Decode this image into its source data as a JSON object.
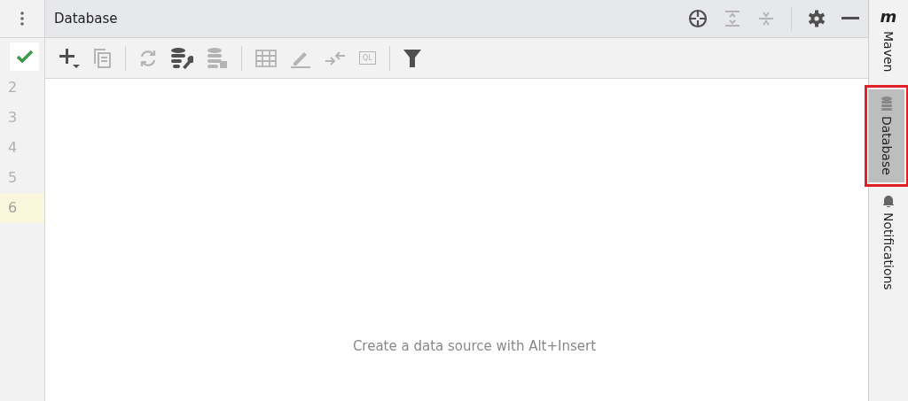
{
  "gutter": {
    "lines": [
      {
        "number": "2",
        "current": false
      },
      {
        "number": "3",
        "current": false
      },
      {
        "number": "4",
        "current": false
      },
      {
        "number": "5",
        "current": false
      },
      {
        "number": "6",
        "current": true
      }
    ]
  },
  "panel": {
    "title": "Database",
    "header_actions": [
      {
        "kind": "locate",
        "disabled": false
      },
      {
        "kind": "expand",
        "disabled": true
      },
      {
        "kind": "collapse",
        "disabled": true
      },
      {
        "kind": "separator"
      },
      {
        "kind": "settings",
        "disabled": false
      },
      {
        "kind": "minimize",
        "disabled": false
      }
    ],
    "toolbar": [
      {
        "kind": "add",
        "disabled": false
      },
      {
        "kind": "copy",
        "disabled": true
      },
      {
        "kind": "separator"
      },
      {
        "kind": "refresh",
        "disabled": true
      },
      {
        "kind": "properties",
        "disabled": false
      },
      {
        "kind": "stop",
        "disabled": true
      },
      {
        "kind": "separator"
      },
      {
        "kind": "table",
        "disabled": true
      },
      {
        "kind": "edit",
        "disabled": true
      },
      {
        "kind": "jump",
        "disabled": true
      },
      {
        "kind": "console",
        "disabled": true,
        "label": "QL"
      },
      {
        "kind": "separator"
      },
      {
        "kind": "filter",
        "disabled": false
      }
    ],
    "empty_text": "Create a data source with Alt+Insert"
  },
  "side_tabs": [
    {
      "label": "Maven",
      "icon_text": "m",
      "kind": "maven",
      "selected": false,
      "highlighted": false
    },
    {
      "label": "Database",
      "kind": "database",
      "selected": true,
      "highlighted": true
    },
    {
      "label": "Notifications",
      "kind": "bell",
      "selected": false,
      "highlighted": false
    }
  ]
}
